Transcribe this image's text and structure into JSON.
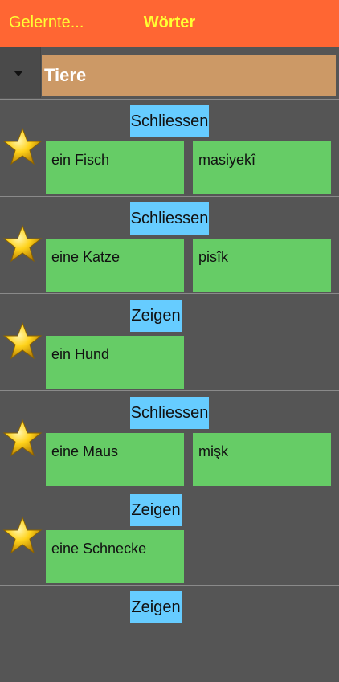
{
  "nav": {
    "back_label": "Gelernte...",
    "title": "Wörter"
  },
  "category": {
    "selected": "Tiere"
  },
  "rows": [
    {
      "toggle": "Schliessen",
      "german": "ein Fisch",
      "kurdish": "masiyekî"
    },
    {
      "toggle": "Schliessen",
      "german": "eine Katze",
      "kurdish": "pisîk"
    },
    {
      "toggle": "Zeigen",
      "german": "ein Hund",
      "kurdish": ""
    },
    {
      "toggle": "Schliessen",
      "german": "eine Maus",
      "kurdish": "mişk"
    },
    {
      "toggle": "Zeigen",
      "german": "eine Schnecke",
      "kurdish": ""
    },
    {
      "toggle": "Zeigen",
      "german": "",
      "kurdish": ""
    }
  ],
  "colors": {
    "navbar": "#ff6633",
    "nav_text": "#ffff33",
    "category": "#cc9966",
    "toggle": "#66ccff",
    "card": "#66cc66",
    "background": "#555555"
  },
  "icons": {
    "row_icon": "star-icon",
    "dropdown_icon": "triangle-down-icon"
  }
}
